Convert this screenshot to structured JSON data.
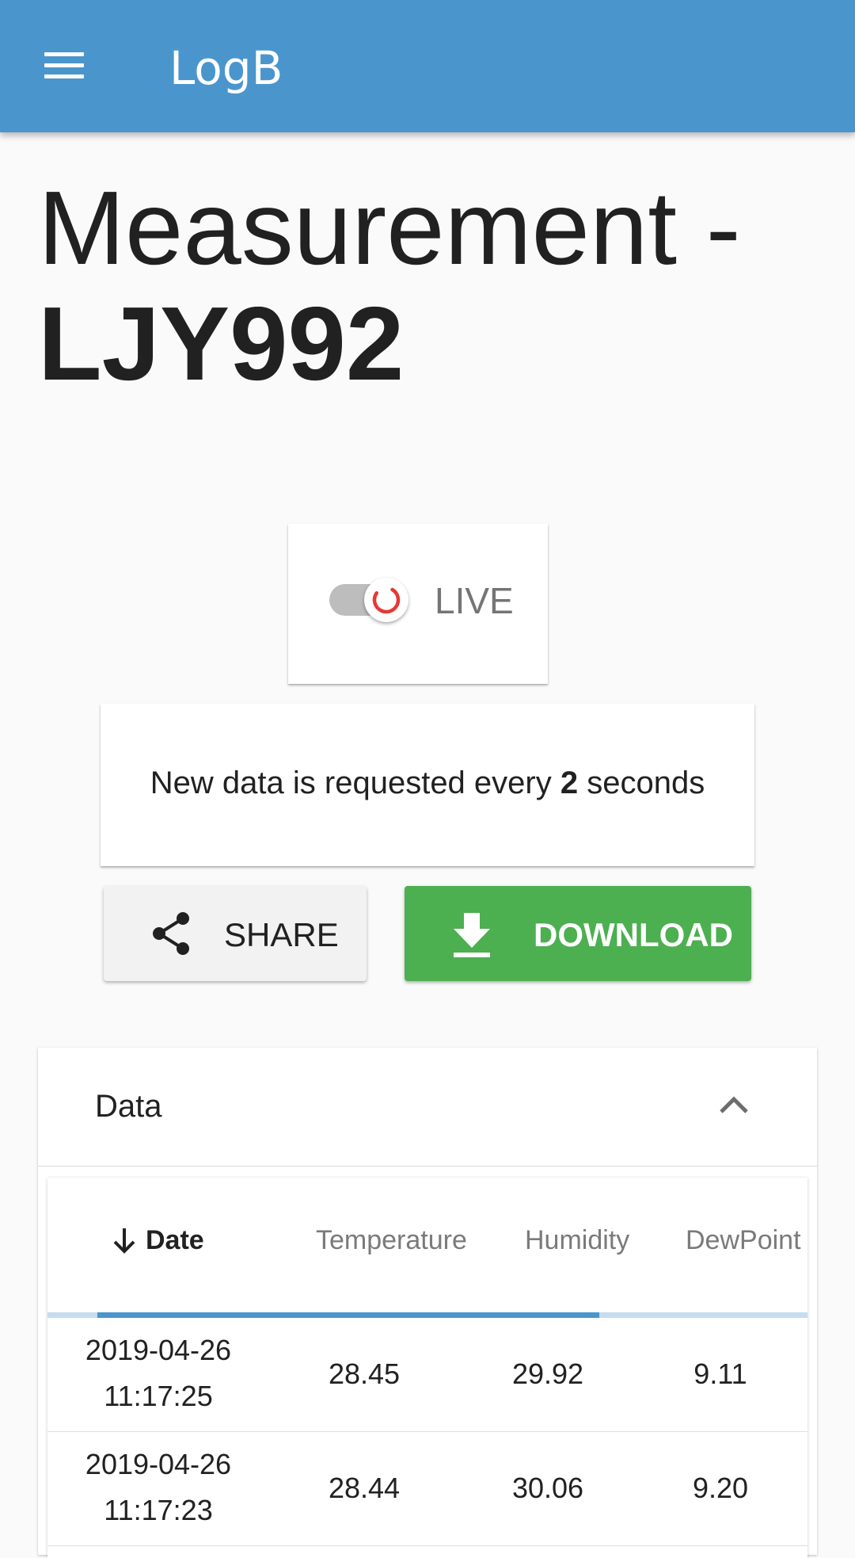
{
  "appbar": {
    "brand": "LogB",
    "menu_icon": "menu-icon"
  },
  "title": {
    "line1": "Measurement -",
    "line2": "LJY992"
  },
  "live": {
    "label": "LIVE",
    "enabled": false
  },
  "info": {
    "prefix": "New data is requested every ",
    "interval": "2",
    "suffix": " seconds"
  },
  "actions": {
    "share_label": "SHARE",
    "download_label": "DOWNLOAD"
  },
  "colors": {
    "appbar": "#4a96cc",
    "download": "#4caf50",
    "spinner": "#e53935"
  },
  "panel": {
    "title": "Data"
  },
  "table": {
    "headers": [
      "Date",
      "Temperature",
      "Humidity",
      "DewPoint"
    ],
    "rows": [
      {
        "date_line1": "2019-04-26",
        "date_line2": "11:17:25",
        "temperature": "28.45",
        "humidity": "29.92",
        "dewpoint": "9.11"
      },
      {
        "date_line1": "2019-04-26",
        "date_line2": "11:17:23",
        "temperature": "28.44",
        "humidity": "30.06",
        "dewpoint": "9.20"
      }
    ]
  }
}
